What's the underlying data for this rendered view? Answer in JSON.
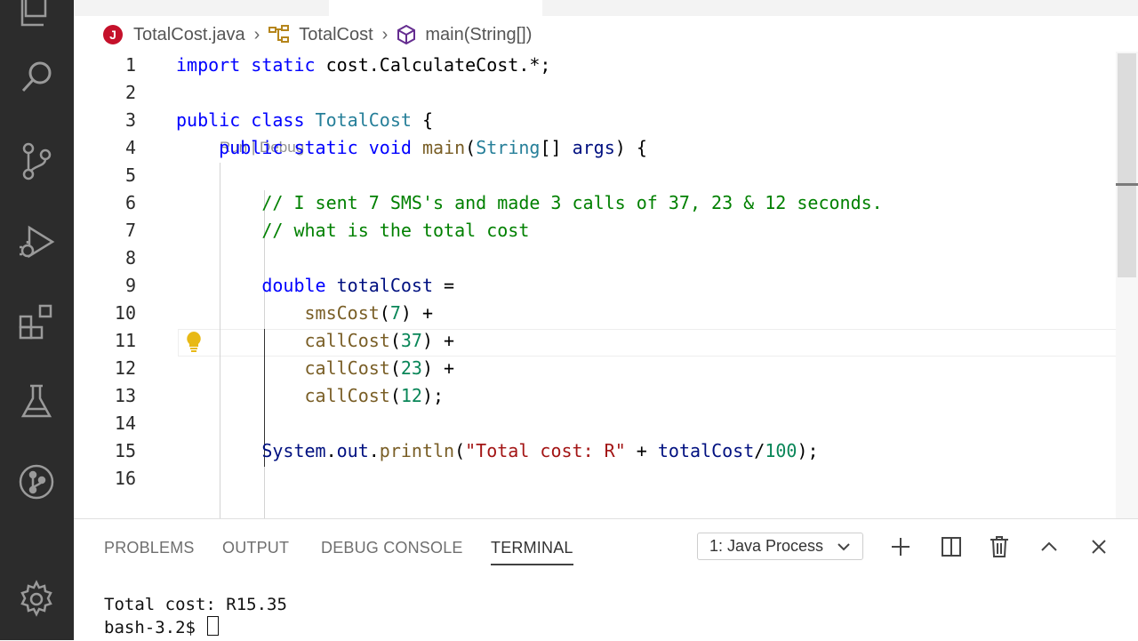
{
  "breadcrumb": {
    "file_badge": "J",
    "file": "TotalCost.java",
    "class": "TotalCost",
    "method": "main(String[])"
  },
  "codelens": "Run | Debug",
  "lines": [
    {
      "n": "1",
      "parts": [
        [
          "kw",
          "import "
        ],
        [
          "kw",
          "static "
        ],
        [
          "plain",
          "cost.CalculateCost.*;"
        ]
      ]
    },
    {
      "n": "2",
      "parts": []
    },
    {
      "n": "3",
      "parts": [
        [
          "kw",
          "public "
        ],
        [
          "kw",
          "class "
        ],
        [
          "ty",
          "TotalCost"
        ],
        [
          "plain",
          " {"
        ]
      ]
    },
    {
      "n": "4",
      "parts": [
        [
          "plain",
          "    "
        ],
        [
          "kw",
          "public "
        ],
        [
          "kw",
          "static "
        ],
        [
          "kw",
          "void "
        ],
        [
          "fn",
          "main"
        ],
        [
          "plain",
          "("
        ],
        [
          "ty",
          "String"
        ],
        [
          "plain",
          "[] "
        ],
        [
          "var",
          "args"
        ],
        [
          "plain",
          ") {"
        ]
      ]
    },
    {
      "n": "5",
      "parts": []
    },
    {
      "n": "6",
      "parts": [
        [
          "com",
          "        // I sent 7 SMS's and made 3 calls of 37, 23 & 12 seconds."
        ]
      ]
    },
    {
      "n": "7",
      "parts": [
        [
          "com",
          "        // what is the total cost"
        ]
      ]
    },
    {
      "n": "8",
      "parts": []
    },
    {
      "n": "9",
      "parts": [
        [
          "plain",
          "        "
        ],
        [
          "kw",
          "double "
        ],
        [
          "var",
          "totalCost"
        ],
        [
          "plain",
          " ="
        ]
      ]
    },
    {
      "n": "10",
      "parts": [
        [
          "plain",
          "            "
        ],
        [
          "fn",
          "smsCost"
        ],
        [
          "plain",
          "("
        ],
        [
          "num",
          "7"
        ],
        [
          "plain",
          ") +"
        ]
      ]
    },
    {
      "n": "11",
      "parts": [
        [
          "plain",
          "            "
        ],
        [
          "fn",
          "callCost"
        ],
        [
          "plain",
          "("
        ],
        [
          "num",
          "37"
        ],
        [
          "plain",
          ") +"
        ]
      ]
    },
    {
      "n": "12",
      "parts": [
        [
          "plain",
          "            "
        ],
        [
          "fn",
          "callCost"
        ],
        [
          "plain",
          "("
        ],
        [
          "num",
          "23"
        ],
        [
          "plain",
          ") +"
        ]
      ]
    },
    {
      "n": "13",
      "parts": [
        [
          "plain",
          "            "
        ],
        [
          "fn",
          "callCost"
        ],
        [
          "plain",
          "("
        ],
        [
          "num",
          "12"
        ],
        [
          "plain",
          ");"
        ]
      ]
    },
    {
      "n": "14",
      "parts": []
    },
    {
      "n": "15",
      "parts": [
        [
          "plain",
          "        "
        ],
        [
          "var",
          "System"
        ],
        [
          "plain",
          "."
        ],
        [
          "var",
          "out"
        ],
        [
          "plain",
          "."
        ],
        [
          "fn",
          "println"
        ],
        [
          "plain",
          "("
        ],
        [
          "str",
          "\"Total cost: R\""
        ],
        [
          "plain",
          " + "
        ],
        [
          "var",
          "totalCost"
        ],
        [
          "plain",
          "/"
        ],
        [
          "num",
          "100"
        ],
        [
          "plain",
          ");"
        ]
      ]
    },
    {
      "n": "16",
      "parts": []
    }
  ],
  "panel": {
    "tabs": [
      "PROBLEMS",
      "OUTPUT",
      "DEBUG CONSOLE",
      "TERMINAL"
    ],
    "active_tab": "TERMINAL",
    "terminal_select": "1: Java Process"
  },
  "terminal": {
    "output": "Total cost: R15.35",
    "prompt": "bash-3.2$ "
  },
  "icons": {
    "activity_bar": [
      "explorer-icon",
      "search-icon",
      "source-control-icon",
      "run-debug-icon",
      "extensions-icon",
      "testing-icon",
      "git-graph-icon",
      "settings-gear-icon"
    ],
    "panel_actions": [
      "add-terminal-icon",
      "split-terminal-icon",
      "trash-icon",
      "maximize-panel-icon",
      "close-panel-icon"
    ]
  },
  "colors": {
    "keyword": "#0000ff",
    "type": "#267f99",
    "function": "#795e26",
    "string": "#a31515",
    "number": "#098658",
    "comment": "#008000",
    "java_badge": "#c5112b",
    "activity_bar": "#2c2c2c"
  }
}
